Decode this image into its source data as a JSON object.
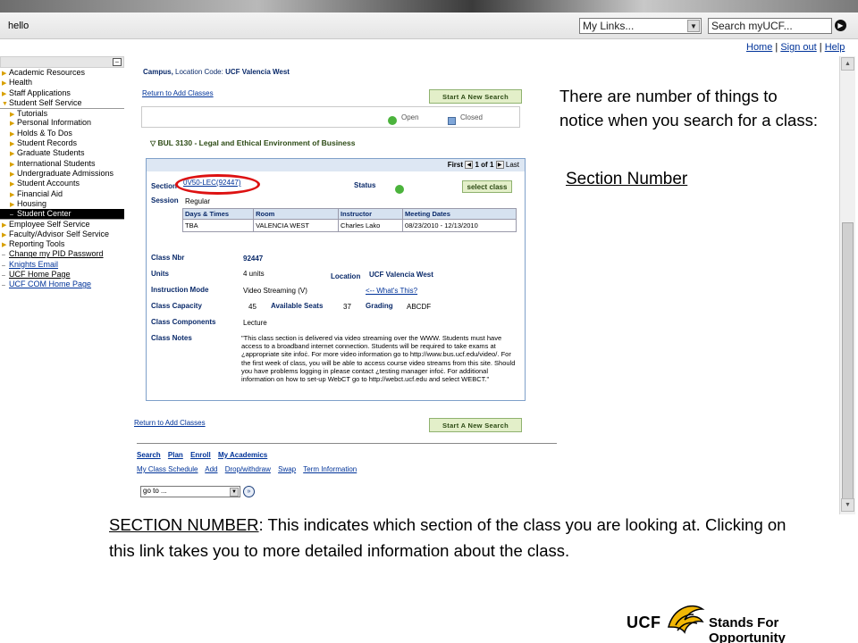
{
  "topbar": {
    "greeting": "hello",
    "my_links": "My Links...",
    "search_placeholder": "Search myUCF...",
    "links": [
      "Home",
      "Sign out",
      "Help"
    ]
  },
  "leftnav": {
    "items": [
      {
        "label": "Academic Resources"
      },
      {
        "label": "Health"
      },
      {
        "label": "Staff Applications"
      },
      {
        "label": "Student Self Service"
      },
      {
        "label": "Tutorials"
      },
      {
        "label": "Personal Information"
      },
      {
        "label": "Holds & To Dos"
      },
      {
        "label": "Student Records"
      },
      {
        "label": "Graduate Students"
      },
      {
        "label": "International Students"
      },
      {
        "label": "Undergraduate Admissions"
      },
      {
        "label": "Student Accounts"
      },
      {
        "label": "Financial Aid"
      },
      {
        "label": "Housing"
      },
      {
        "label": "Student Center"
      },
      {
        "label": "Employee Self Service"
      },
      {
        "label": "Faculty/Advisor Self Service"
      },
      {
        "label": "Reporting Tools"
      },
      {
        "label": "Change my PID Password"
      },
      {
        "label": "Knights Email"
      },
      {
        "label": "UCF Home Page"
      },
      {
        "label": "UCF COM Home Page"
      }
    ]
  },
  "content": {
    "campus_label": "Campus,",
    "location_code_label": "Location Code:",
    "location_code": "UCF Valencia West",
    "return_link": "Return to Add Classes",
    "start_new_search": "Start A New Search",
    "legend_open": "Open",
    "legend_closed": "Closed",
    "course_title": "BUL 3130 - Legal and Ethical Environment of Business",
    "nav_first": "First",
    "nav_count": "1 of 1",
    "nav_last": "Last",
    "section_label": "Section",
    "section_value": "0V50-LEC(92447)",
    "status_label": "Status",
    "select_class": "select class",
    "session_label": "Session",
    "session_value": "Regular",
    "meeting_headers": [
      "Days & Times",
      "Room",
      "Instructor",
      "Meeting Dates"
    ],
    "meeting_row": [
      "TBA",
      "VALENCIA WEST",
      "Charles Lako",
      "08/23/2010 - 12/13/2010"
    ],
    "class_nbr_label": "Class Nbr",
    "class_nbr": "92447",
    "units_label": "Units",
    "units": "4 units",
    "location_label": "Location",
    "location": "UCF Valencia West",
    "instruction_mode_label": "Instruction Mode",
    "instruction_mode": "Video Streaming (V)",
    "whats_this": "<-- What's This?",
    "class_capacity_label": "Class Capacity",
    "class_capacity": "45",
    "available_seats_label": "Available Seats",
    "available_seats": "37",
    "grading_label": "Grading",
    "grading": "ABCDF",
    "class_components_label": "Class Components",
    "class_components": "Lecture",
    "class_notes_label": "Class Notes",
    "class_notes": "\"This class section is delivered via video streaming over the WWW. Students must have access to a broadband internet connection. Students will be required to take exams at ¿appropriate site infoċ. For more video information go to http://www.bus.ucf.edu/video/. For the first week of class, you will be able to access course video streams from this site. Should you have problems logging in please contact ¿testing manager infoċ. For additional information on how to set-up WebCT go to http://webct.ucf.edu and select WEBCT.\"",
    "bottom_row1": [
      "Search",
      "Plan",
      "Enroll",
      "My Academics"
    ],
    "bottom_row2": [
      "My Class Schedule",
      "Add",
      "Drop/withdraw",
      "Swap",
      "Term Information"
    ],
    "goto_value": "go to ..."
  },
  "annotations": {
    "intro": "There are number of things to notice when you search for a class:",
    "section_number": "Section Number",
    "caption_term": "SECTION NUMBER",
    "caption_body": ": This indicates which section of the class you are looking at. Clicking on this link takes you to more detailed information about the class."
  },
  "footer": {
    "logo_text": "UCF",
    "tagline": "Stands For Opportunity"
  },
  "colors": {
    "link": "#003399",
    "highlight_ellipse": "#dd1111",
    "status_open": "#4bb33c",
    "brand_gold": "#f2b705"
  },
  "icons": {
    "status": "green-circle-icon",
    "nav_arrow": "triangle-right-icon",
    "mascot": "pegasus-logo-icon"
  }
}
